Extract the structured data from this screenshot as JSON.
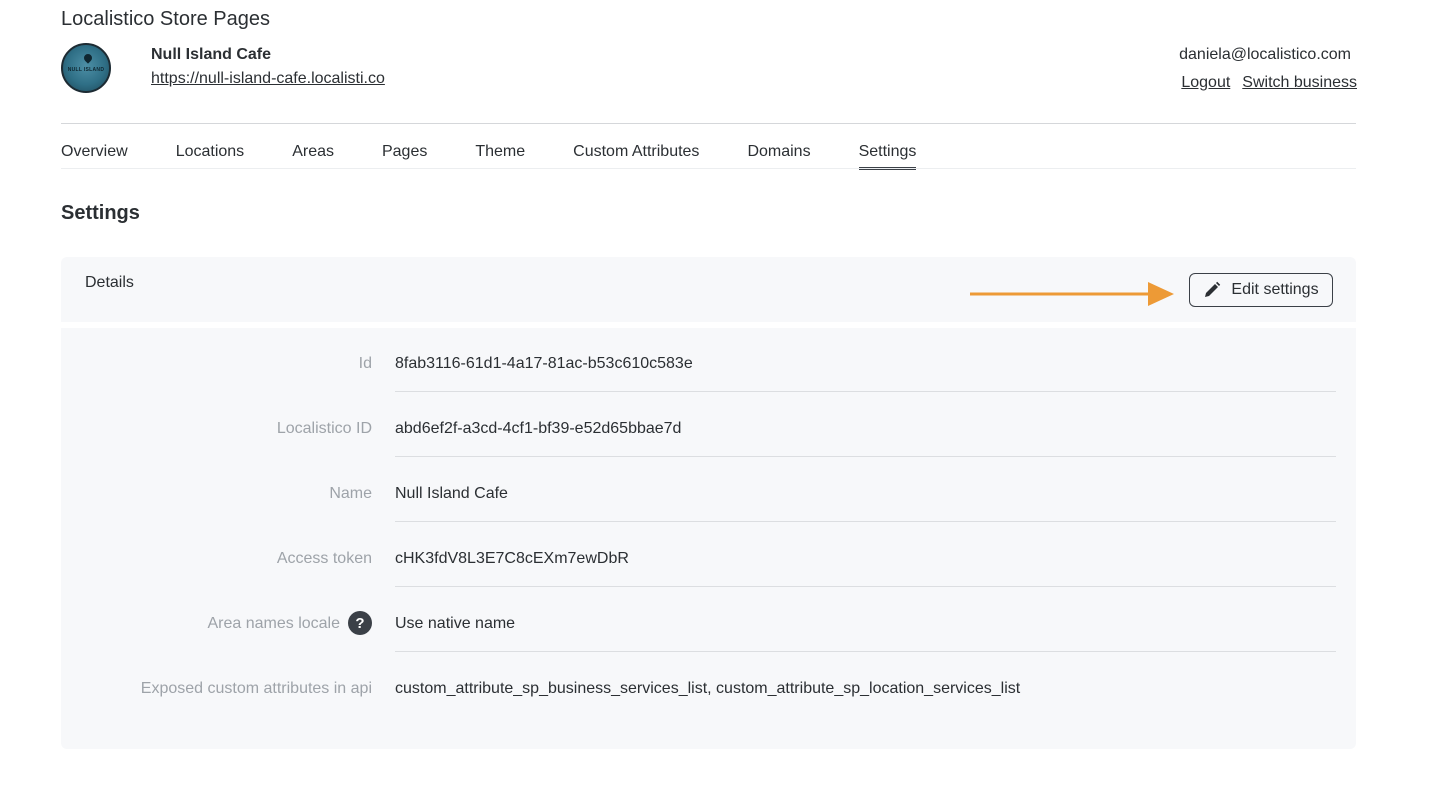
{
  "app": {
    "title": "Localistico Store Pages"
  },
  "business": {
    "name": "Null Island Cafe",
    "url": "https://null-island-cafe.localisti.co",
    "avatar_text": "NULL ISLAND"
  },
  "user": {
    "email": "daniela@localistico.com",
    "logout_label": "Logout",
    "switch_label": "Switch business"
  },
  "tabs": [
    {
      "label": "Overview"
    },
    {
      "label": "Locations"
    },
    {
      "label": "Areas"
    },
    {
      "label": "Pages"
    },
    {
      "label": "Theme"
    },
    {
      "label": "Custom Attributes"
    },
    {
      "label": "Domains"
    },
    {
      "label": "Settings",
      "active": true
    }
  ],
  "page": {
    "title": "Settings"
  },
  "details": {
    "title": "Details",
    "edit_button_label": "Edit settings",
    "edit_icon": "pencil-icon",
    "rows": [
      {
        "label": "Id",
        "value": "8fab3116-61d1-4a17-81ac-b53c610c583e"
      },
      {
        "label": "Localistico ID",
        "value": "abd6ef2f-a3cd-4cf1-bf39-e52d65bbae7d"
      },
      {
        "label": "Name",
        "value": "Null Island Cafe"
      },
      {
        "label": "Access token",
        "value": "cHK3fdV8L3E7C8cEXm7ewDbR"
      },
      {
        "label": "Area names locale",
        "value": "Use native name",
        "help_icon": "question-mark-icon",
        "help_glyph": "?"
      },
      {
        "label": "Exposed custom attributes in api",
        "value": "custom_attribute_sp_business_services_list, custom_attribute_sp_location_services_list"
      }
    ]
  },
  "colors": {
    "accent_arrow": "#ed9a36",
    "panel_bg": "#f7f8fa",
    "muted_label": "#9ea3a9",
    "text": "#2b2f33"
  }
}
